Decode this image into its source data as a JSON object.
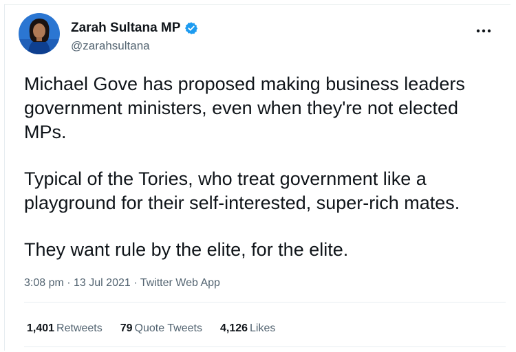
{
  "tweet": {
    "author": {
      "display_name": "Zarah Sultana MP",
      "handle": "@zarahsultana",
      "verified_icon": "verified-badge-icon",
      "accent_color": "#1d9bf0"
    },
    "more_icon": "more-options-icon",
    "paragraphs": [
      "Michael Gove has proposed making business leaders government ministers, even when they're not elected MPs.",
      "Typical of the Tories, who treat government like a playground for their self-interested, super-rich mates.",
      "They want rule by the elite, for the elite."
    ],
    "meta": {
      "time": "3:08 pm",
      "separator": " · ",
      "date": "13 Jul 2021",
      "source": "Twitter Web App"
    },
    "stats": {
      "retweets_count": "1,401",
      "retweets_label": "Retweets",
      "quotes_count": "79",
      "quotes_label": "Quote Tweets",
      "likes_count": "4,126",
      "likes_label": "Likes"
    }
  }
}
